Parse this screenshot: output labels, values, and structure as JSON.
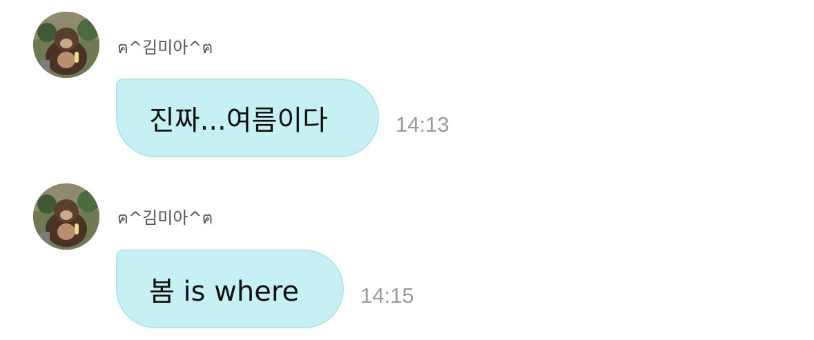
{
  "messages": [
    {
      "sender": "ฅ^김미아^ฅ",
      "avatar_icon": "gorilla-avatar-icon",
      "text": "진짜...여름이다",
      "time": "14:13"
    },
    {
      "sender": "ฅ^김미아^ฅ",
      "avatar_icon": "gorilla-avatar-icon",
      "text": "봄 is where",
      "time": "14:15"
    }
  ],
  "colors": {
    "bubble_fill": "#c7f0f5",
    "bubble_border": "#b2e4ea",
    "sender_text": "#555555",
    "timestamp_text": "#9a9a9a",
    "message_text": "#111111"
  }
}
